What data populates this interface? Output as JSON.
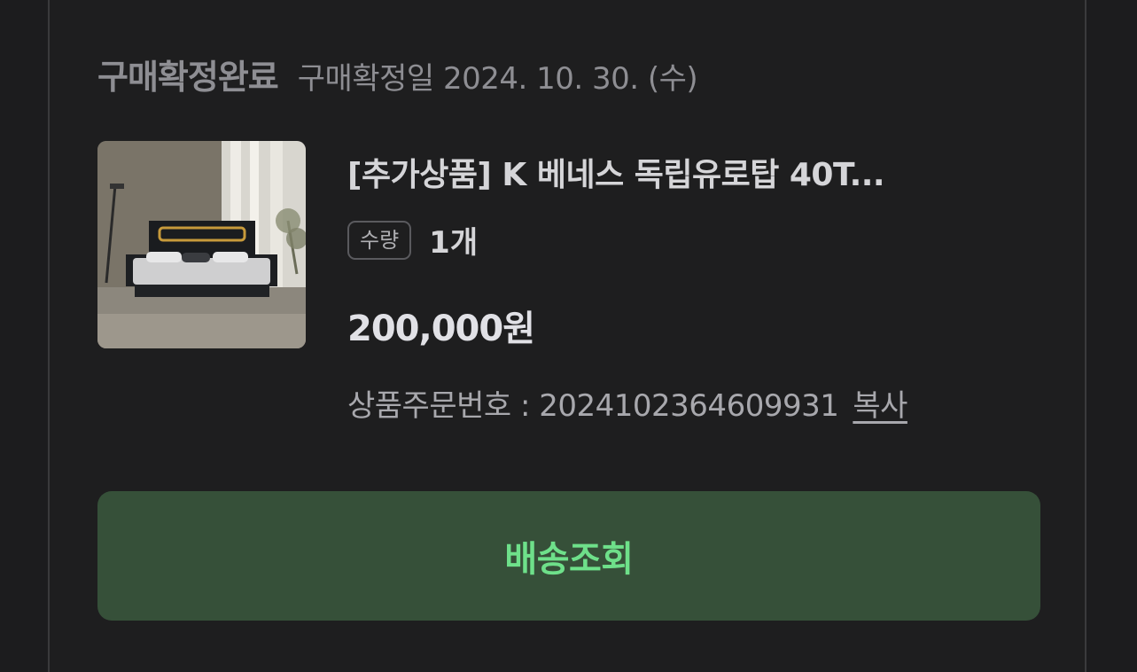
{
  "order": {
    "status": "구매확정완료",
    "confirm_date": "구매확정일 2024. 10. 30. (수)"
  },
  "product": {
    "image_icon": "bed-product-photo",
    "name": "[추가상품] K 베네스 독립유로탑 40T...",
    "quantity_label": "수량",
    "quantity_value": "1개",
    "price": "200,000원",
    "order_number_text": "상품주문번호 : 2024102364609931",
    "copy_label": "복사"
  },
  "actions": {
    "track_delivery": "배송조회"
  },
  "colors": {
    "accent_green": "#6ee08a",
    "button_bg": "#365039"
  }
}
